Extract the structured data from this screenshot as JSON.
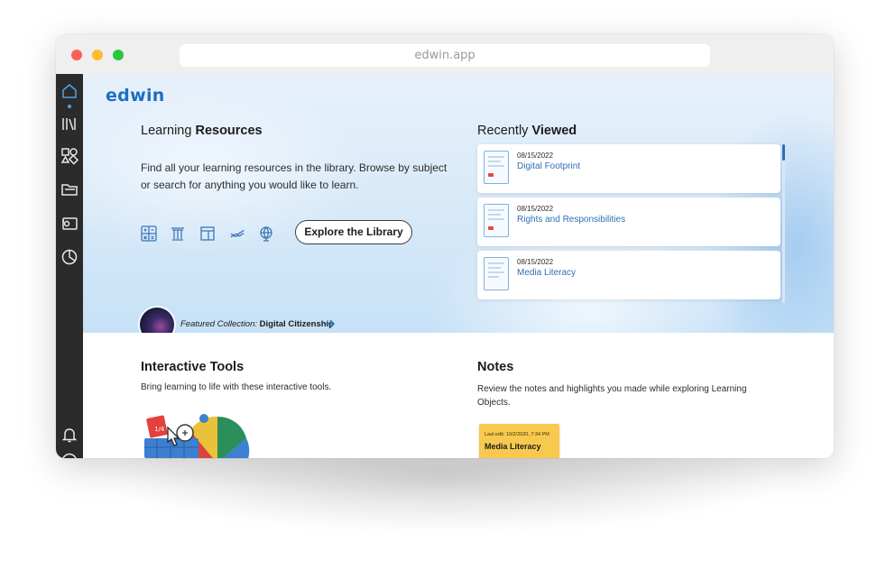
{
  "browser": {
    "url": "edwin.app"
  },
  "app": {
    "logo": "edwin"
  },
  "sidebar": {
    "items": [
      {
        "name": "home",
        "active": true
      },
      {
        "name": "library"
      },
      {
        "name": "subjects"
      },
      {
        "name": "folder"
      },
      {
        "name": "tools"
      },
      {
        "name": "reports"
      },
      {
        "name": "notifications"
      }
    ]
  },
  "learning_resources": {
    "title_light": "Learning ",
    "title_bold": "Resources",
    "description": "Find all your learning resources in the library. Browse by subject or search for anything you would like to learn.",
    "subject_icons": [
      "math-icon",
      "social-studies-icon",
      "ela-icon",
      "science-icon",
      "world-languages-icon"
    ],
    "explore_button": "Explore the Library",
    "featured_label": "Featured Collection:",
    "featured_name": "Digital Citizenship"
  },
  "recently_viewed": {
    "title_light": "Recently ",
    "title_bold": "Viewed",
    "items": [
      {
        "date": "08/15/2022",
        "name": "Digital Footprint"
      },
      {
        "date": "08/15/2022",
        "name": "Rights and Responsibilities"
      },
      {
        "date": "08/15/2022",
        "name": "Media Literacy"
      }
    ]
  },
  "interactive_tools": {
    "title": "Interactive Tools",
    "description": "Bring learning to life with these interactive tools."
  },
  "notes": {
    "title": "Notes",
    "description": "Review the notes and highlights you made while exploring Learning Objects.",
    "card": {
      "last_edit": "Last edit: 10/2/2020, 7:34 PM",
      "name": "Media Literacy"
    }
  },
  "colors": {
    "accent": "#1f6fc1",
    "link": "#2f6fb5",
    "sidebar": "#2b2b2b",
    "note": "#f8c94f"
  }
}
